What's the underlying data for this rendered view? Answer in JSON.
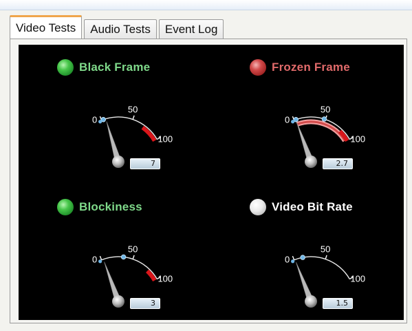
{
  "tabs": [
    {
      "label": "Video Tests",
      "active": true
    },
    {
      "label": "Audio Tests",
      "active": false
    },
    {
      "label": "Event Log",
      "active": false
    }
  ],
  "colors": {
    "green_led": "#47c64a",
    "red_led": "#d24a4a",
    "white_led": "#e9e9e9",
    "alarm_band": "#d9161a",
    "needle": "#b9b9b9",
    "marker": "#6fb6e6"
  },
  "gauges": [
    {
      "title": "Black Frame",
      "led": "green",
      "scale_min": "0",
      "scale_mid": "50",
      "scale_max": "100",
      "value": 7,
      "readout": "7",
      "threshold_low": 3,
      "red_band": [
        70,
        100
      ],
      "upper_marker": null,
      "highlighted_arc": false
    },
    {
      "title": "Frozen Frame",
      "led": "red",
      "scale_min": "0",
      "scale_mid": "50",
      "scale_max": "100",
      "value": 2.7,
      "readout": "2.7",
      "threshold_low": 3,
      "red_band": [
        80,
        100
      ],
      "upper_marker": 48,
      "highlighted_arc": true
    },
    {
      "title": "Blockiness",
      "led": "green",
      "scale_min": "0",
      "scale_mid": "50",
      "scale_max": "100",
      "value": 3,
      "readout": "3",
      "threshold_low": 35,
      "red_band": [
        80,
        100
      ],
      "upper_marker": null,
      "highlighted_arc": false
    },
    {
      "title": "Video Bit Rate",
      "led": "white",
      "scale_min": "0",
      "scale_mid": "50",
      "scale_max": "100",
      "value": 1.5,
      "readout": "1.5",
      "threshold_low": 14,
      "red_band": null,
      "upper_marker": null,
      "highlighted_arc": false
    }
  ]
}
